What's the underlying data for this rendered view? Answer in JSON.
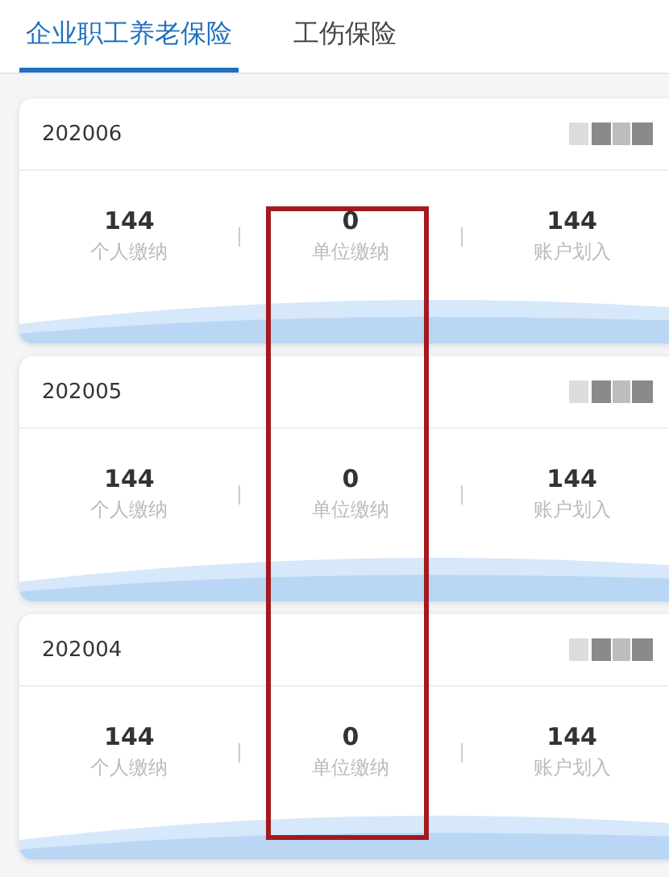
{
  "tabs": [
    {
      "label": "企业职工养老保险",
      "selected": true
    },
    {
      "label": "工伤保险",
      "selected": false
    }
  ],
  "records": [
    {
      "period": "202006",
      "stats": [
        {
          "value": "144",
          "label": "个人缴纳"
        },
        {
          "value": "0",
          "label": "单位缴纳"
        },
        {
          "value": "144",
          "label": "账户划入"
        }
      ]
    },
    {
      "period": "202005",
      "stats": [
        {
          "value": "144",
          "label": "个人缴纳"
        },
        {
          "value": "0",
          "label": "单位缴纳"
        },
        {
          "value": "144",
          "label": "账户划入"
        }
      ]
    },
    {
      "period": "202004",
      "stats": [
        {
          "value": "144",
          "label": "个人缴纳"
        },
        {
          "value": "0",
          "label": "单位缴纳"
        },
        {
          "value": "144",
          "label": "账户划入"
        }
      ]
    }
  ]
}
